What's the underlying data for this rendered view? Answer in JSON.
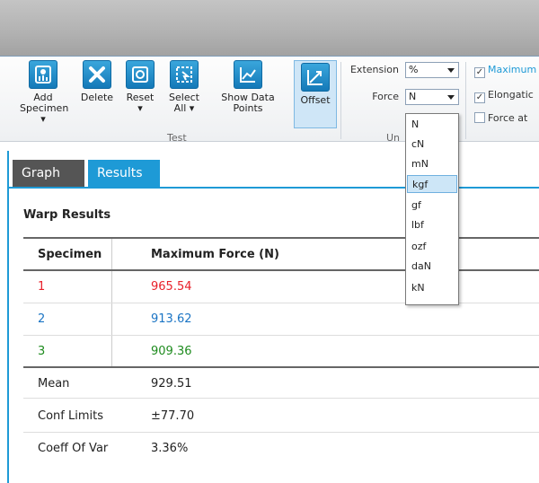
{
  "ribbon": {
    "buttons": [
      {
        "label": "Add\nSpecimen ▾",
        "icon": "add-specimen-icon"
      },
      {
        "label": "Delete",
        "icon": "delete-x-icon"
      },
      {
        "label": "Reset\n▾",
        "icon": "reset-icon"
      },
      {
        "label": "Select\nAll ▾",
        "icon": "select-all-icon"
      },
      {
        "label": "Show Data\nPoints",
        "icon": "show-data-points-icon"
      },
      {
        "label": "Offset",
        "icon": "offset-icon"
      }
    ],
    "test_group_label": "Test",
    "units_group_label": "Un",
    "extension_label": "Extension",
    "extension_value": "%",
    "force_label": "Force",
    "force_value": "N",
    "checks": [
      {
        "label": "Maximum",
        "checked": true
      },
      {
        "label": "Elongatic",
        "checked": true
      },
      {
        "label": "Force at",
        "checked": false
      }
    ]
  },
  "tabs": {
    "graph": "Graph",
    "results": "Results"
  },
  "results": {
    "title": "Warp Results",
    "columns": [
      "Specimen",
      "Maximum Force (N)"
    ],
    "rows": [
      {
        "specimen": "1",
        "value": "965.54",
        "color": "#e8202a"
      },
      {
        "specimen": "2",
        "value": "913.62",
        "color": "#1a74c4"
      },
      {
        "specimen": "3",
        "value": "909.36",
        "color": "#1e8b1e"
      }
    ],
    "stats": [
      {
        "label": "Mean",
        "value": "929.51"
      },
      {
        "label": "Conf Limits",
        "value": "±77.70"
      },
      {
        "label": "Coeff Of Var",
        "value": "3.36%"
      }
    ]
  },
  "force_dropdown": {
    "options": [
      "N",
      "cN",
      "mN",
      "kgf",
      "gf",
      "lbf",
      "ozf",
      "daN",
      "kN"
    ],
    "highlighted": "kgf"
  },
  "colors": {
    "accent": "#1e9ad6",
    "tab_inactive": "#555555"
  }
}
